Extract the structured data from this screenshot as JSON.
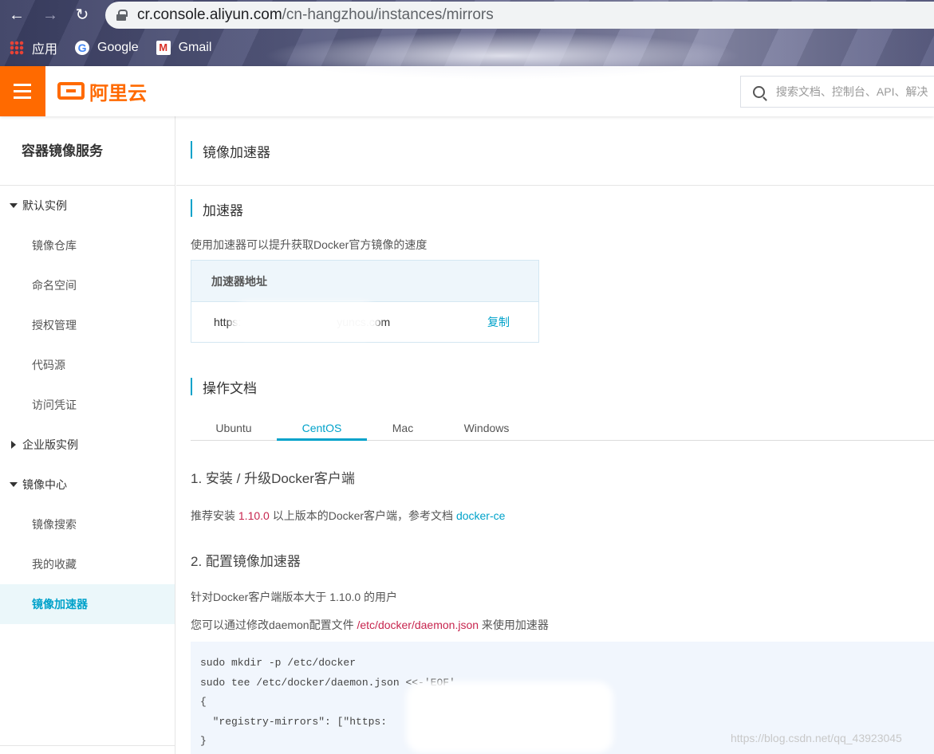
{
  "browser": {
    "url_host": "cr.console.aliyun.com",
    "url_path": "/cn-hangzhou/instances/mirrors",
    "bookmarks": [
      {
        "label": "应用",
        "icon": "apps-grid-icon"
      },
      {
        "label": "Google",
        "icon": "google-icon"
      },
      {
        "label": "Gmail",
        "icon": "gmail-icon"
      }
    ]
  },
  "topbar": {
    "logo_text": "阿里云",
    "search_placeholder": "搜索文档、控制台、API、解决"
  },
  "sidebar": {
    "title": "容器镜像服务",
    "groups": [
      {
        "label": "默认实例",
        "expanded": true,
        "items": [
          "镜像仓库",
          "命名空间",
          "授权管理",
          "代码源",
          "访问凭证"
        ]
      },
      {
        "label": "企业版实例",
        "expanded": false,
        "items": []
      },
      {
        "label": "镜像中心",
        "expanded": true,
        "items": [
          "镜像搜索",
          "我的收藏",
          "镜像加速器"
        ]
      }
    ],
    "active_item": "镜像加速器"
  },
  "main": {
    "page_title": "镜像加速器",
    "accelerator": {
      "section_title": "加速器",
      "description": "使用加速器可以提升获取Docker官方镜像的速度",
      "table_header": "加速器地址",
      "address_start": "https:",
      "address_end": "yuncs.com",
      "copy_label": "复制"
    },
    "docs": {
      "section_title": "操作文档",
      "tabs": [
        "Ubuntu",
        "CentOS",
        "Mac",
        "Windows"
      ],
      "active_tab": "CentOS",
      "step1_title": "1. 安装 / 升级Docker客户端",
      "step1_text_a": "推荐安装 ",
      "step1_version": "1.10.0",
      "step1_text_b": " 以上版本的Docker客户端，参考文档 ",
      "step1_link": "docker-ce",
      "step2_title": "2. 配置镜像加速器",
      "step2_text": "针对Docker客户端版本大于 1.10.0 的用户",
      "step2_text2_a": "您可以通过修改daemon配置文件 ",
      "step2_path": "/etc/docker/daemon.json",
      "step2_text2_b": " 来使用加速器",
      "code_lines": [
        "sudo mkdir -p /etc/docker",
        "sudo tee /etc/docker/daemon.json <<-'EOF'",
        "{",
        "  \"registry-mirrors\": [\"https:",
        "}"
      ]
    }
  },
  "watermark": "https://blog.csdn.net/qq_43923045",
  "colors": {
    "brand": "#ff6a00",
    "accent": "#00a2ca",
    "highlight": "#c7254e"
  }
}
